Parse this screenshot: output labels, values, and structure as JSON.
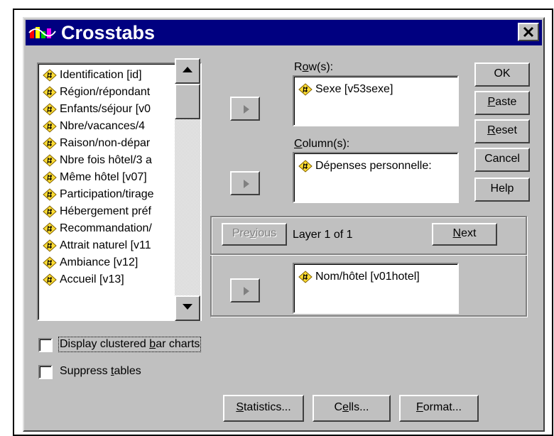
{
  "window": {
    "title": "Crosstabs",
    "app_icon": "spss-icon",
    "close_icon": "close-icon"
  },
  "source_list": {
    "items": [
      "Identification [id]",
      "Région/répondant",
      "Enfants/séjour [v0",
      "Nbre/vacances/4",
      "Raison/non-dépar",
      "Nbre fois hôtel/3 a",
      "Même hôtel [v07]",
      "Participation/tirage",
      "Hébergement préf",
      "Recommandation/",
      "Attrait naturel [v11",
      "Ambiance [v12]",
      "Accueil [v13]"
    ]
  },
  "rows": {
    "label_pre": "R",
    "label_u": "o",
    "label_post": "w(s):",
    "items": [
      "Sexe [v53sexe]"
    ]
  },
  "columns": {
    "label_pre": "",
    "label_u": "C",
    "label_post": "olumn(s):",
    "items": [
      "Dépenses personnelle:"
    ]
  },
  "layer": {
    "previous_pre": "Pre",
    "previous_u": "v",
    "previous_post": "ious",
    "text": "Layer 1 of 1",
    "next_pre": "",
    "next_u": "N",
    "next_post": "ext",
    "items": [
      "Nom/hôtel [v01hotel]"
    ]
  },
  "buttons": {
    "ok": "OK",
    "paste_u": "P",
    "paste_post": "aste",
    "reset_u": "R",
    "reset_post": "eset",
    "cancel": "Cancel",
    "help": "Help"
  },
  "options": {
    "clustered_pre": "Display clustered ",
    "clustered_u": "b",
    "clustered_post": "ar charts",
    "clustered_checked": false,
    "suppress_pre": "Suppress ",
    "suppress_u": "t",
    "suppress_post": "ables",
    "suppress_checked": false
  },
  "bottom_buttons": {
    "statistics_u": "S",
    "statistics_post": "tatistics...",
    "cells_pre": "C",
    "cells_u": "e",
    "cells_post": "lls...",
    "format_u": "F",
    "format_post": "ormat..."
  },
  "colors": {
    "title_bg": "#000080",
    "face": "#c0c0c0",
    "var_icon_fill": "#ffdd33"
  }
}
